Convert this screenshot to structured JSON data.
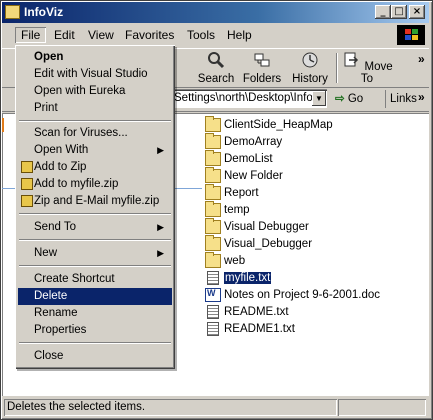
{
  "window": {
    "title": "InfoViz"
  },
  "titlebar_buttons": {
    "minimize": "_",
    "maximize": "□",
    "close": "×"
  },
  "menubar": {
    "items": [
      "File",
      "Edit",
      "View",
      "Favorites",
      "Tools",
      "Help"
    ]
  },
  "toolbar": {
    "search": "Search",
    "folders": "Folders",
    "history": "History",
    "move_to": "Move To",
    "more": "»"
  },
  "address": {
    "path": "Settings\\north\\Desktop\\InfoV",
    "go": "Go",
    "links": "Links",
    "more": "»"
  },
  "file_menu": {
    "open": "Open",
    "edit_vs": "Edit with Visual Studio",
    "open_eureka": "Open with Eureka",
    "print": "Print",
    "scan": "Scan for Viruses...",
    "open_with": "Open With",
    "add_zip": "Add to Zip",
    "add_myfile": "Add to myfile.zip",
    "zip_email": "Zip and E-Mail myfile.zip",
    "send_to": "Send To",
    "new": "New",
    "create_shortcut": "Create Shortcut",
    "delete": "Delete",
    "rename": "Rename",
    "properties": "Properties",
    "close": "Close"
  },
  "files": [
    {
      "name": "ClientSide_HeapMap",
      "type": "folder"
    },
    {
      "name": "DemoArray",
      "type": "folder"
    },
    {
      "name": "DemoList",
      "type": "folder"
    },
    {
      "name": "New Folder",
      "type": "folder"
    },
    {
      "name": "Report",
      "type": "folder"
    },
    {
      "name": "temp",
      "type": "folder"
    },
    {
      "name": "Visual Debugger",
      "type": "folder"
    },
    {
      "name": "Visual_Debugger",
      "type": "folder"
    },
    {
      "name": "web",
      "type": "folder"
    },
    {
      "name": "myfile.txt",
      "type": "text",
      "selected": true
    },
    {
      "name": "Notes on Project 9-6-2001.doc",
      "type": "doc"
    },
    {
      "name": "README.txt",
      "type": "text"
    },
    {
      "name": "README1.txt",
      "type": "text"
    }
  ],
  "status": {
    "text": "Deletes the selected items."
  }
}
